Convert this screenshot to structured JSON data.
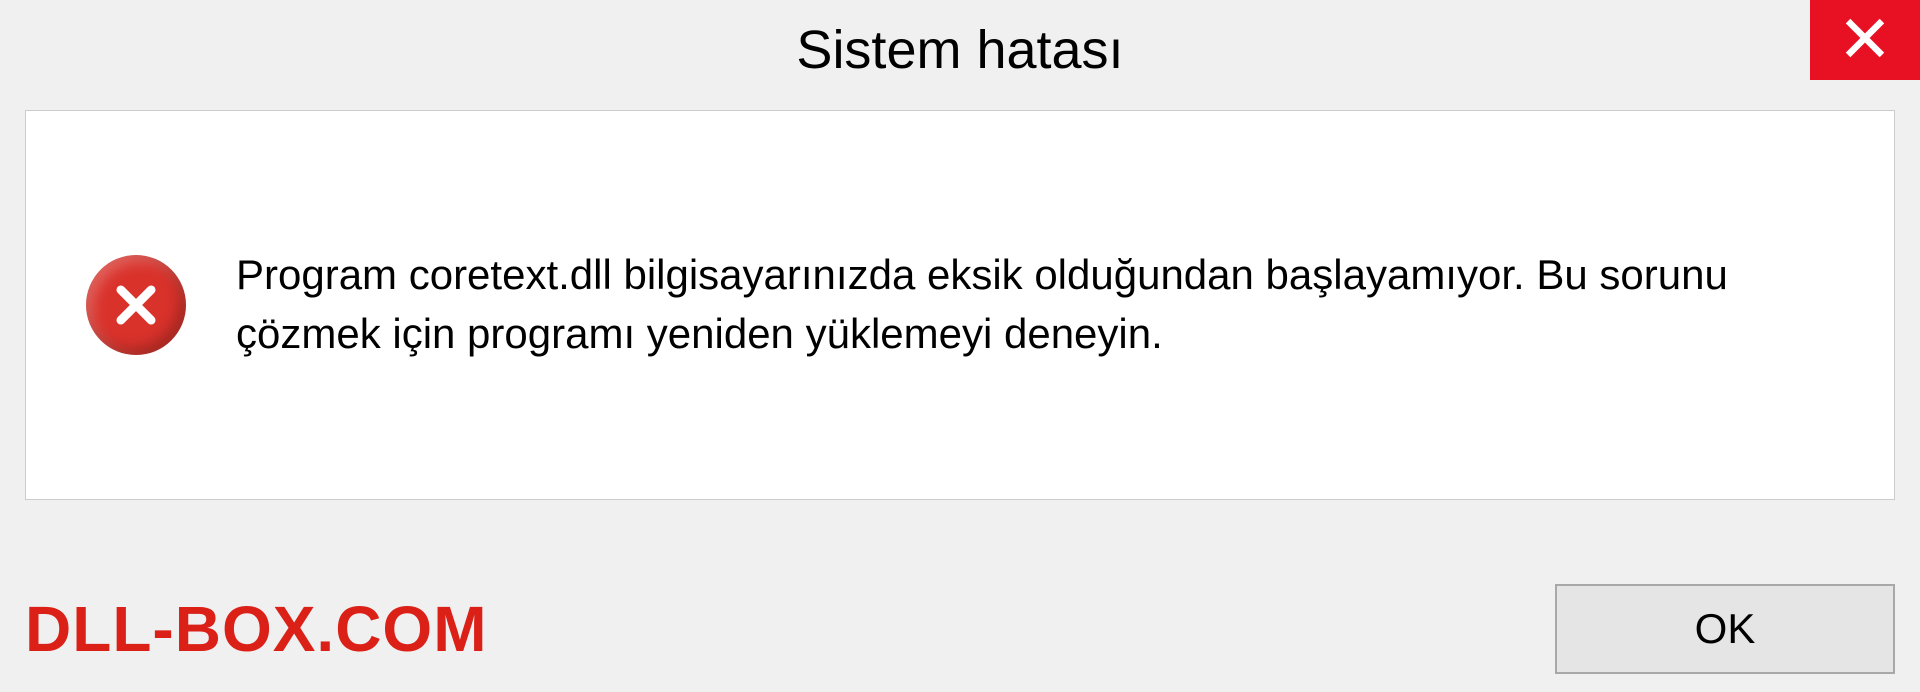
{
  "dialog": {
    "title": "Sistem hatası",
    "message": "Program coretext.dll bilgisayarınızda eksik olduğundan başlayamıyor. Bu sorunu çözmek için programı yeniden yüklemeyi deneyin.",
    "ok_label": "OK"
  },
  "watermark": "DLL-BOX.COM"
}
